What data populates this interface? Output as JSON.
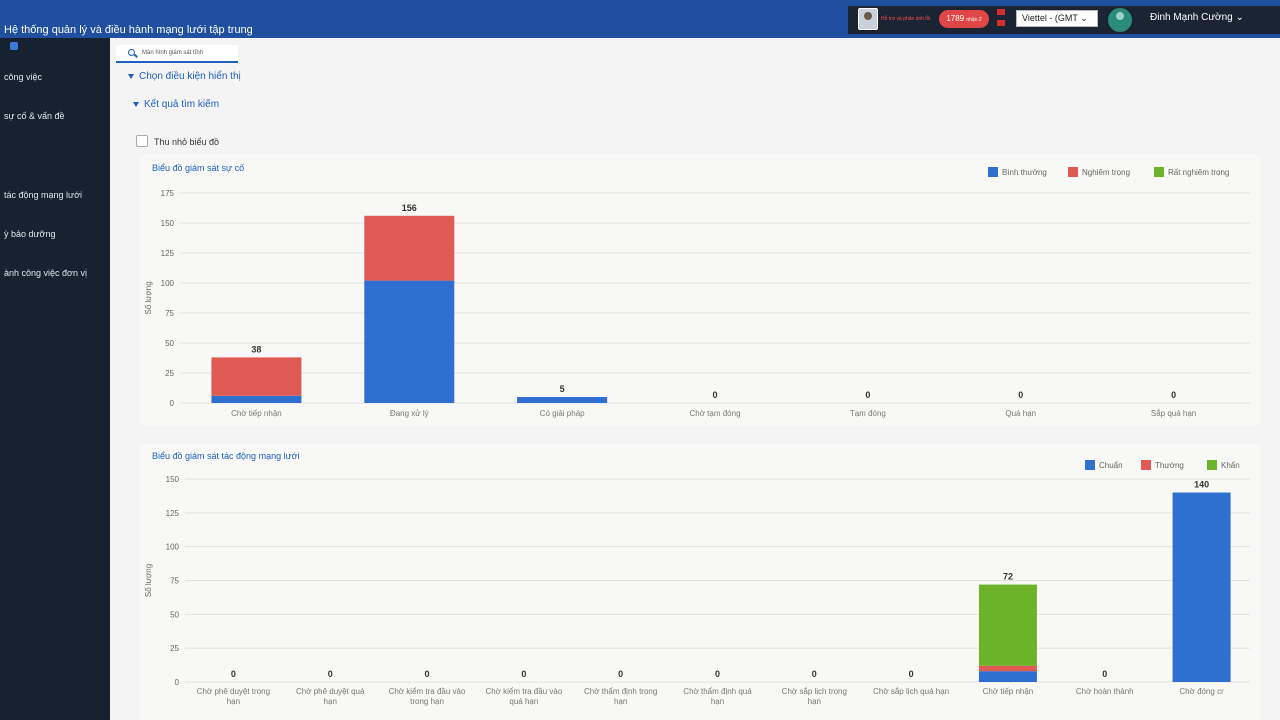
{
  "app": {
    "title": "Hệ thống quản lý và điều hành mạng lưới tập trung",
    "user_note": "Hỗ trợ và phản ánh lỗi",
    "badge_count": "1789",
    "badge_suffix": "nhận 2",
    "timezone": "Viettel - (GMT",
    "user_name": "Đinh Mạnh Cường"
  },
  "sidebar": {
    "items": [
      {
        "label": "công việc"
      },
      {
        "label": "sự cố & vấn đề"
      },
      {
        "label": "tác động mạng lưới"
      },
      {
        "label": "ỳ bảo dưỡng"
      },
      {
        "label": "ành công việc đơn vị"
      }
    ]
  },
  "tab": {
    "label": "Màn hình giám sát tĩnh"
  },
  "sections": {
    "conditions": "Chọn điều kiện hiển thị",
    "results": "Kết quả tìm kiếm"
  },
  "checkbox_label": "Thu nhỏ biểu đồ",
  "chart_data": [
    {
      "type": "bar",
      "stacked": true,
      "title": "Biểu đồ giám sát sự cố",
      "ylabel": "Số lượng",
      "ylim": [
        0,
        175
      ],
      "yticks": [
        0,
        25,
        50,
        75,
        100,
        125,
        150,
        175
      ],
      "legend_position": "top-right",
      "categories": [
        "Chờ tiếp nhận",
        "Đang xử lý",
        "Có giải pháp",
        "Chờ tạm đóng",
        "Tạm đóng",
        "Quá hạn",
        "Sắp quá hạn"
      ],
      "totals": [
        38,
        156,
        5,
        0,
        0,
        0,
        0
      ],
      "series": [
        {
          "name": "Bình thường",
          "color": "#2f6fd0",
          "values": [
            6,
            102,
            5,
            0,
            0,
            0,
            0
          ]
        },
        {
          "name": "Nghiêm trọng",
          "color": "#e05a55",
          "values": [
            32,
            54,
            0,
            0,
            0,
            0,
            0
          ]
        },
        {
          "name": "Rất nghiêm trọng",
          "color": "#6cb32a",
          "values": [
            0,
            0,
            0,
            0,
            0,
            0,
            0
          ]
        }
      ]
    },
    {
      "type": "bar",
      "stacked": true,
      "title": "Biểu đồ giám sát tác động mạng lưới",
      "ylabel": "Số lượng",
      "ylim": [
        0,
        150
      ],
      "yticks": [
        0,
        25,
        50,
        75,
        100,
        125,
        150
      ],
      "legend_position": "top-right",
      "categories": [
        "Chờ phê duyệt trong hạn",
        "Chờ phê duyệt quá hạn",
        "Chờ kiểm tra đầu vào trong hạn",
        "Chờ kiểm tra đầu vào quá hạn",
        "Chờ thẩm định trong hạn",
        "Chờ thẩm định quá hạn",
        "Chờ sắp lịch trong hạn",
        "Chờ sắp lịch quá hạn",
        "Chờ tiếp nhận",
        "Chờ hoàn thành",
        "Chờ đóng cr"
      ],
      "totals": [
        0,
        0,
        0,
        0,
        0,
        0,
        0,
        0,
        72,
        0,
        140
      ],
      "series": [
        {
          "name": "Chuẩn",
          "color": "#2f6fd0",
          "values": [
            0,
            0,
            0,
            0,
            0,
            0,
            0,
            0,
            8,
            0,
            140
          ]
        },
        {
          "name": "Thường",
          "color": "#e05a55",
          "values": [
            0,
            0,
            0,
            0,
            0,
            0,
            0,
            0,
            4,
            0,
            0
          ]
        },
        {
          "name": "Khẩn",
          "color": "#6cb32a",
          "values": [
            0,
            0,
            0,
            0,
            0,
            0,
            0,
            0,
            60,
            0,
            0
          ]
        }
      ]
    }
  ]
}
